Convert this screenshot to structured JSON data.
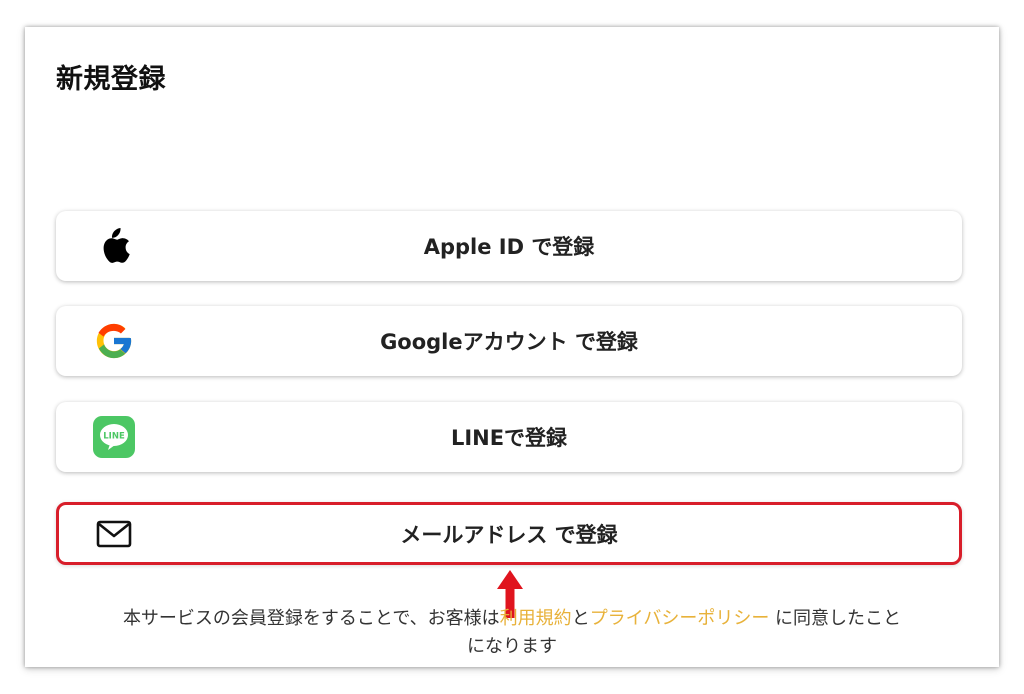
{
  "page": {
    "title": "新規登録"
  },
  "buttons": {
    "apple": {
      "label": "Apple ID で登録",
      "icon": "apple-icon"
    },
    "google": {
      "label": "Googleアカウント で登録",
      "icon": "google-icon"
    },
    "line": {
      "label": "LINEで登録",
      "icon": "line-icon",
      "icon_text": "LINE"
    },
    "mail": {
      "label": "メールアドレス で登録",
      "icon": "mail-icon"
    }
  },
  "terms": {
    "prefix": "本サービスの会員登録をすることで、お客様は",
    "terms_link": "利用規約",
    "connector": "と",
    "privacy_link": "プライバシーポリシー",
    "suffix_line1": " に同意したこと",
    "suffix_line2": "になります"
  },
  "colors": {
    "highlight_border": "#d81e2a",
    "link": "#e8b23a",
    "line_green": "#4cc764",
    "arrow": "#e0141e"
  }
}
